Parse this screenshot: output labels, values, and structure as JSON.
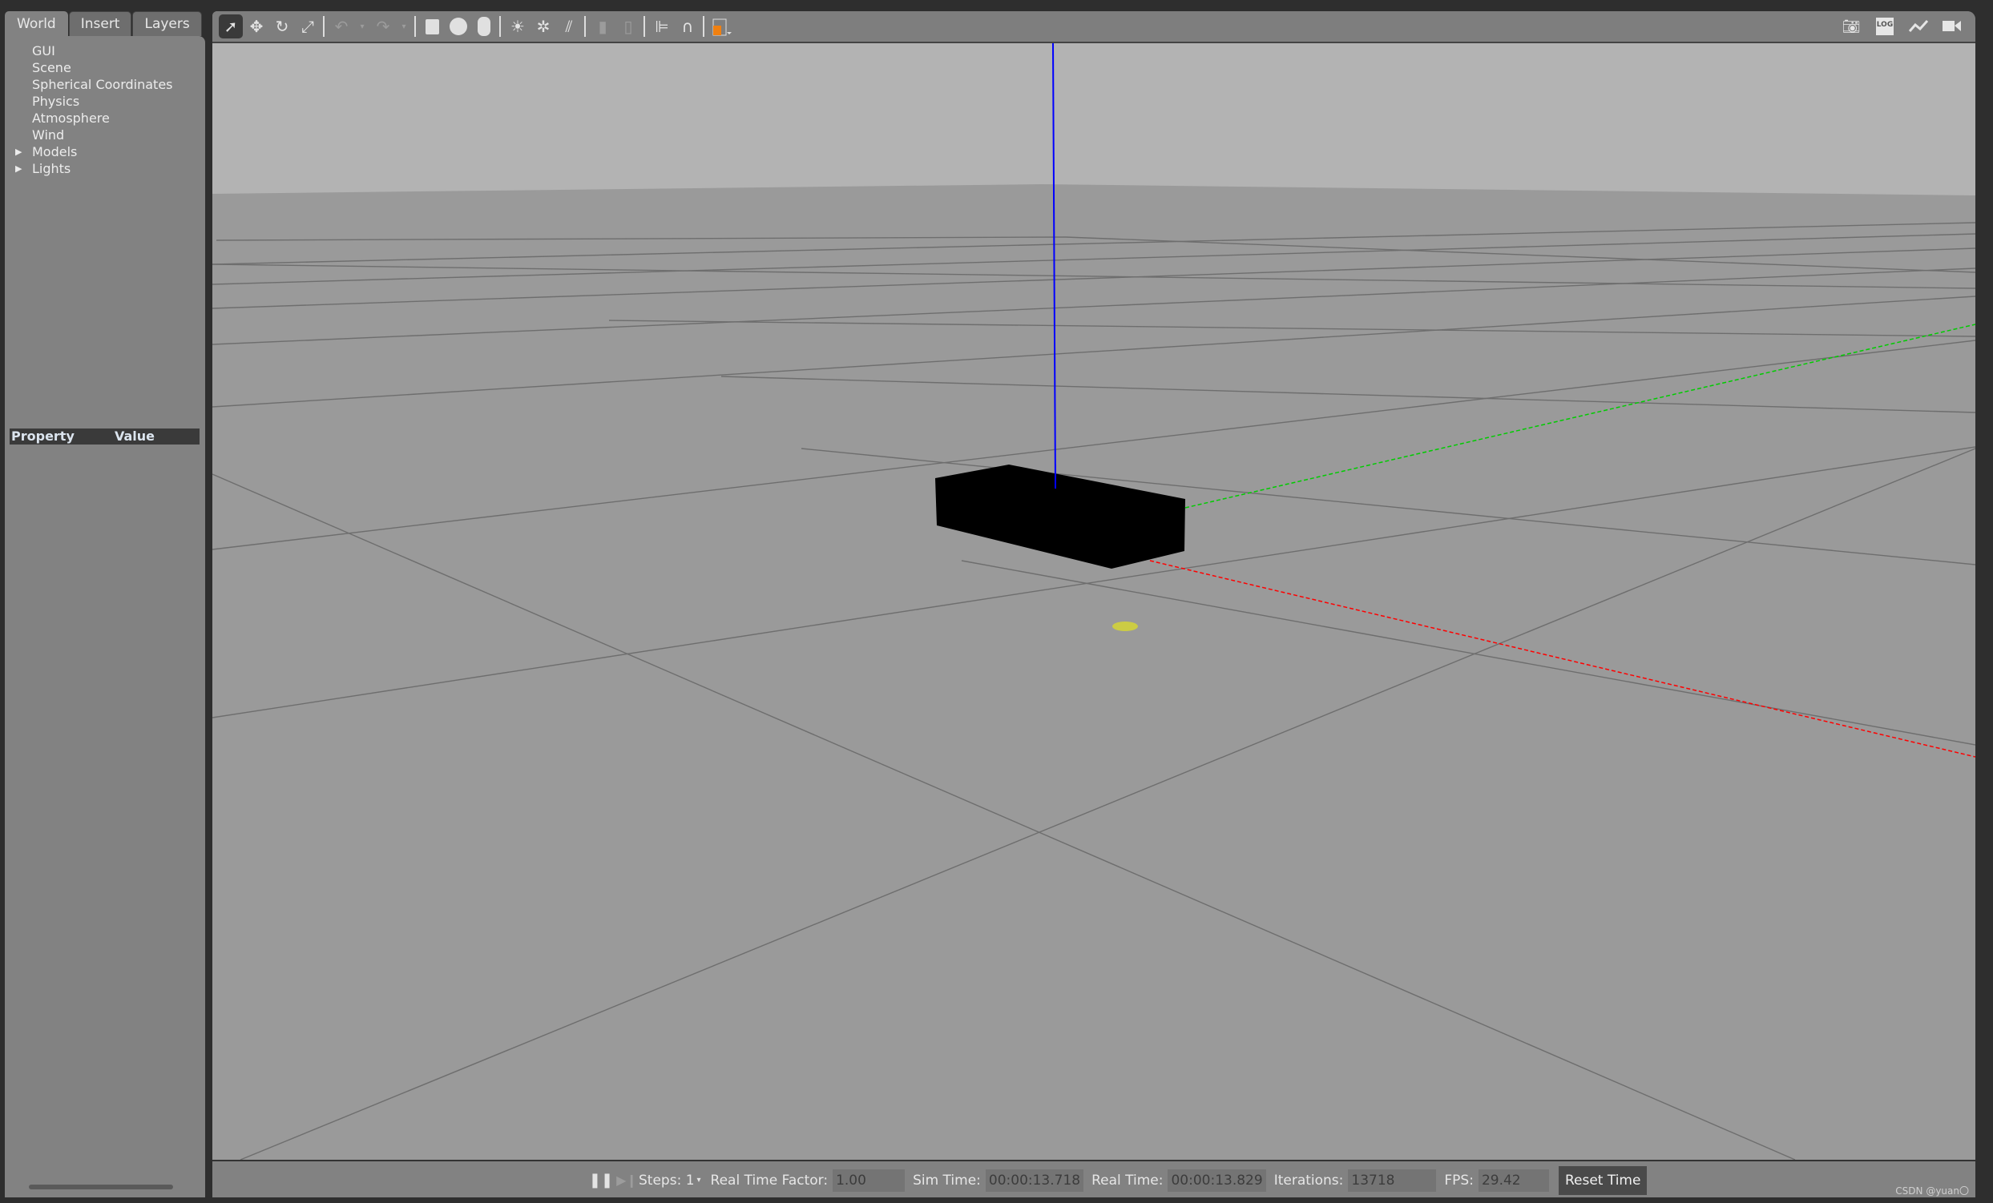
{
  "left_panel": {
    "tabs": [
      {
        "label": "World",
        "active": true
      },
      {
        "label": "Insert"
      },
      {
        "label": "Layers"
      }
    ],
    "tree": [
      {
        "label": "GUI"
      },
      {
        "label": "Scene"
      },
      {
        "label": "Spherical Coordinates"
      },
      {
        "label": "Physics"
      },
      {
        "label": "Atmosphere"
      },
      {
        "label": "Wind"
      },
      {
        "label": "Models",
        "expandable": true
      },
      {
        "label": "Lights",
        "expandable": true
      }
    ],
    "property_header": {
      "property": "Property",
      "value": "Value"
    }
  },
  "toolbar": {
    "left_icons": [
      "select-arrow-icon",
      "translate-icon",
      "rotate-icon",
      "scale-icon",
      "undo-icon",
      "undo-dropdown-icon",
      "redo-icon",
      "redo-dropdown-icon",
      "box-icon",
      "sphere-icon",
      "cylinder-icon",
      "point-light-icon",
      "spot-light-icon",
      "directional-light-icon",
      "copy-icon",
      "paste-icon",
      "align-icon",
      "snap-icon",
      "view-angle-icon"
    ],
    "right_icons": [
      "screenshot-camera-icon",
      "log-icon",
      "plot-icon",
      "video-record-icon"
    ],
    "log_label": "LOG"
  },
  "scene": {
    "sky_color": "#b3b3b3",
    "ground_color": "#9a9a9a",
    "axis_colors": {
      "x": "#ff0000",
      "y": "#00cc00",
      "z": "#0000ff"
    },
    "model_color": "#000000",
    "light_marker_color": "#cccc44"
  },
  "bottom_bar": {
    "steps_label": "Steps: 1",
    "rtf_label": "Real Time Factor:",
    "rtf_value": "1.00",
    "sim_time_label": "Sim Time:",
    "sim_time_value": "00:00:13.718",
    "real_time_label": "Real Time:",
    "real_time_value": "00:00:13.829",
    "iterations_label": "Iterations:",
    "iterations_value": "13718",
    "fps_label": "FPS:",
    "fps_value": "29.42",
    "reset_label": "Reset Time"
  },
  "watermark": "CSDN @yuan〇"
}
